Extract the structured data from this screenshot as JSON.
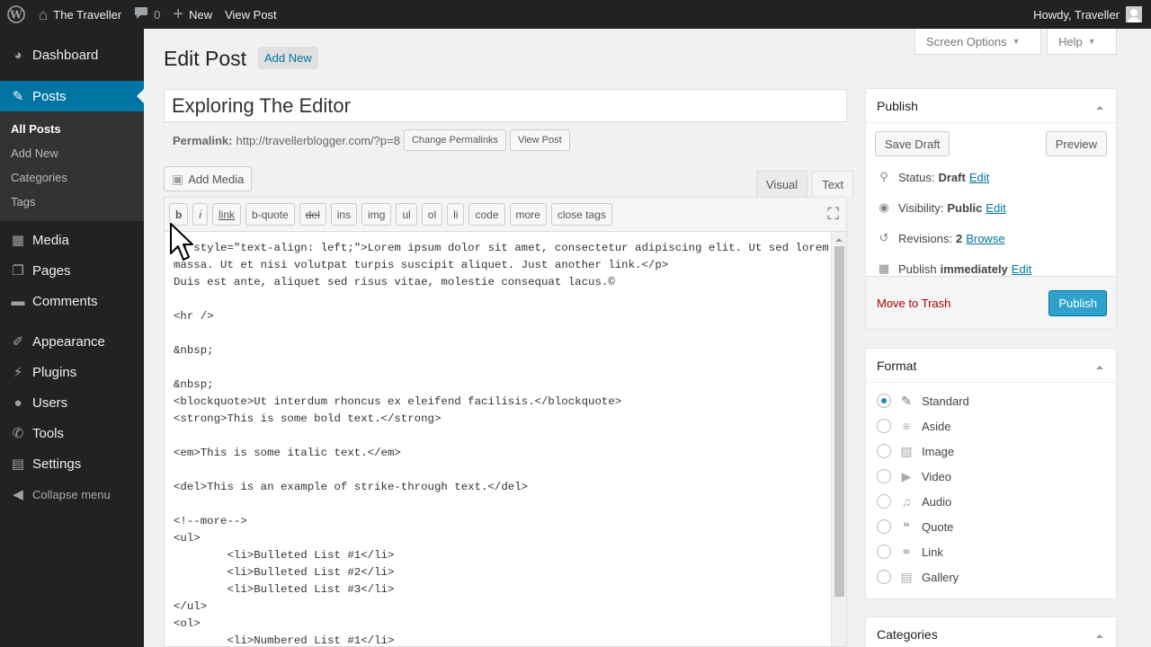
{
  "adminbar": {
    "site_name": "The Traveller",
    "comments_count": "0",
    "new_label": "New",
    "view_post_label": "View Post",
    "howdy": "Howdy, Traveller"
  },
  "sidebar": {
    "dashboard": "Dashboard",
    "posts": "Posts",
    "posts_sub": [
      "All Posts",
      "Add New",
      "Categories",
      "Tags"
    ],
    "media": "Media",
    "pages": "Pages",
    "comments": "Comments",
    "appearance": "Appearance",
    "plugins": "Plugins",
    "users": "Users",
    "tools": "Tools",
    "settings": "Settings",
    "collapse": "Collapse menu"
  },
  "screen_meta": {
    "screen_options": "Screen Options",
    "help": "Help"
  },
  "page": {
    "title": "Edit Post",
    "add_new": "Add New"
  },
  "post": {
    "title": "Exploring The Editor",
    "permalink_label": "Permalink:",
    "permalink_url": "http://travellerblogger.com/?p=8",
    "change_permalinks": "Change Permalinks",
    "view_post": "View Post"
  },
  "editor": {
    "add_media": "Add Media",
    "tab_visual": "Visual",
    "tab_text": "Text",
    "quicktags": [
      "b",
      "i",
      "link",
      "b-quote",
      "del",
      "ins",
      "img",
      "ul",
      "ol",
      "li",
      "code",
      "more",
      "close tags"
    ],
    "content": "<p style=\"text-align: left;\">Lorem ipsum dolor sit amet, consectetur adipiscing elit. Ut sed lorem\nmassa. Ut et nisi volutpat turpis suscipit aliquet. Just another link.</p>\nDuis est ante, aliquet sed risus vitae, molestie consequat lacus.©\n\n<hr />\n\n&nbsp;\n\n&nbsp;\n<blockquote>Ut interdum rhoncus ex eleifend facilisis.</blockquote>\n<strong>This is some bold text.</strong>\n\n<em>This is some italic text.</em>\n\n<del>This is an example of strike-through text.</del>\n\n<!--more-->\n<ul>\n        <li>Bulleted List #1</li>\n        <li>Bulleted List #2</li>\n        <li>Bulleted List #3</li>\n</ul>\n<ol>\n        <li>Numbered List #1</li>"
  },
  "publish": {
    "heading": "Publish",
    "save_draft": "Save Draft",
    "preview": "Preview",
    "status_label": "Status:",
    "status_value": "Draft",
    "visibility_label": "Visibility:",
    "visibility_value": "Public",
    "revisions_label": "Revisions:",
    "revisions_value": "2",
    "browse": "Browse",
    "publish_label": "Publish",
    "publish_value": "immediately",
    "edit": "Edit",
    "trash": "Move to Trash",
    "publish_button": "Publish"
  },
  "format": {
    "heading": "Format",
    "options": [
      "Standard",
      "Aside",
      "Image",
      "Video",
      "Audio",
      "Quote",
      "Link",
      "Gallery"
    ],
    "selected": "Standard"
  },
  "categories": {
    "heading": "Categories"
  },
  "colors": {
    "accent": "#0074a2",
    "publish": "#2ea2cc",
    "trash": "#aa0000"
  }
}
